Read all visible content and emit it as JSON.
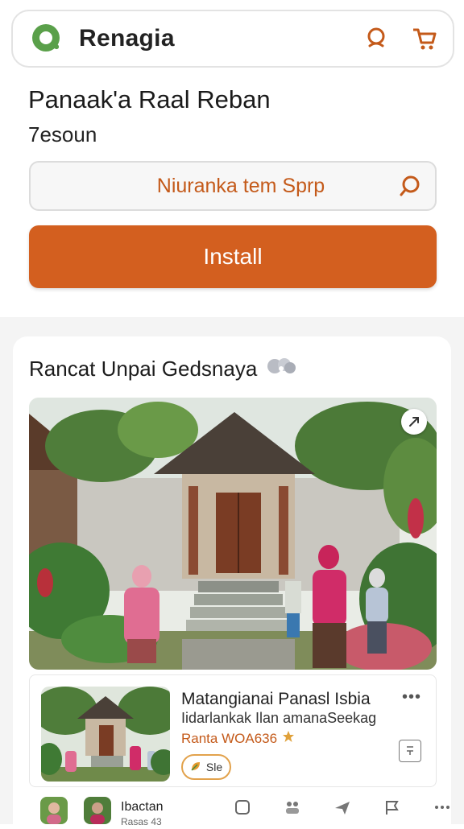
{
  "header": {
    "app_name": "Renagia",
    "icons": [
      "app-logo-icon",
      "search-icon",
      "cart-icon"
    ],
    "accent_color": "#d35f1f"
  },
  "page": {
    "title": "Panaak'a Raal Reban",
    "subtitle": "7esoun"
  },
  "search": {
    "value": "Niuranka tem Sprp"
  },
  "install": {
    "label": "Install"
  },
  "section": {
    "title": "Rancat Unpai Gedsnaya"
  },
  "listing": {
    "title": "Matangianai Panasl Isbia",
    "description": "Iidarlankak Ilan amanaSeekag",
    "rating_text": "Ranta WOA636",
    "tag_label": "Sle",
    "more": "•••"
  },
  "bottom": {
    "label": "Ibactan",
    "sub_label": "Rasas 43"
  }
}
